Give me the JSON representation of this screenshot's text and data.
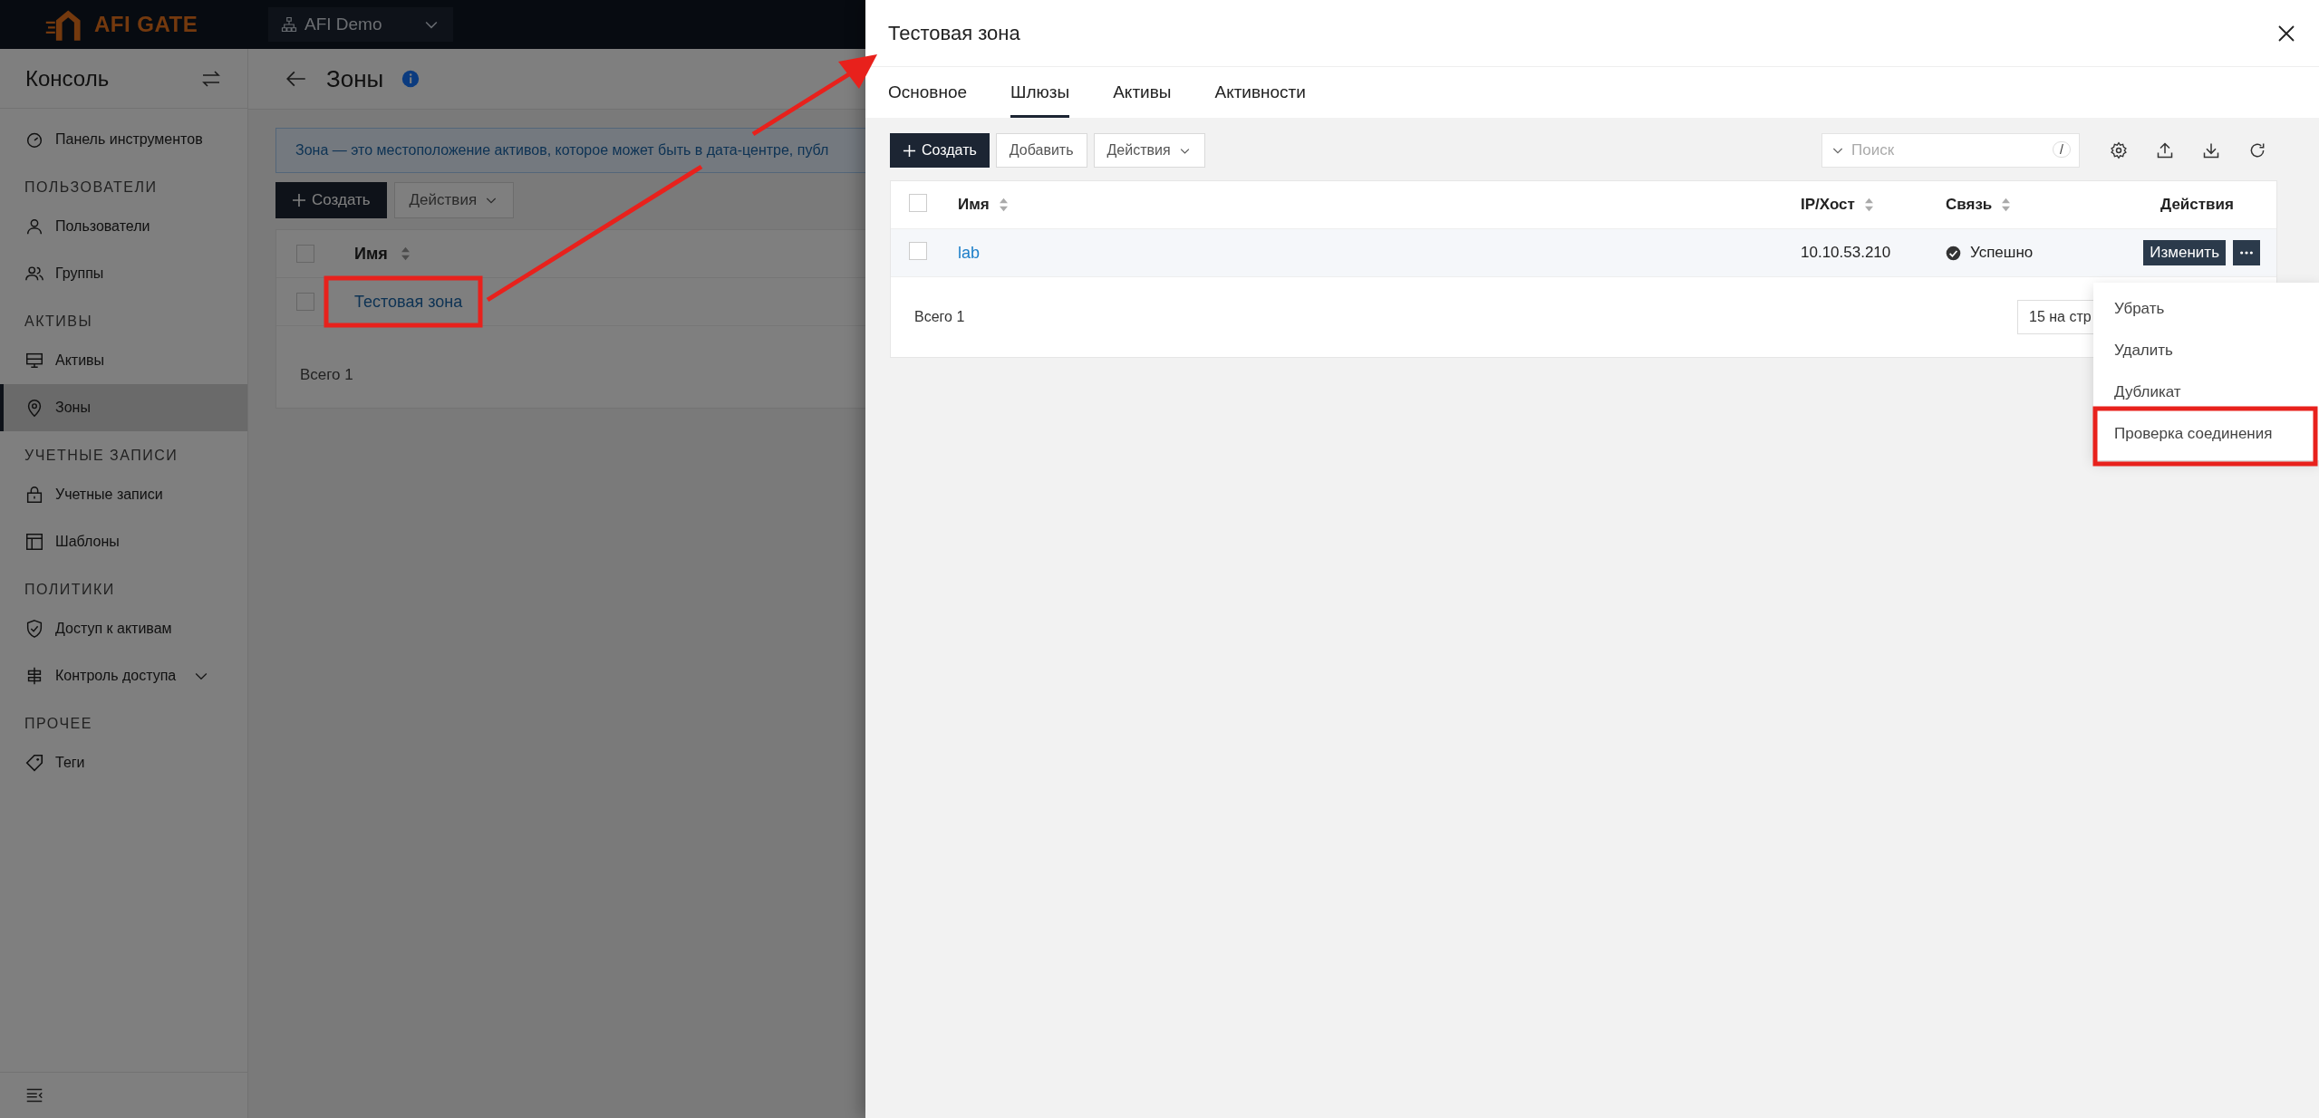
{
  "header": {
    "logo": "AFI GATE",
    "org_selector": "AFI Demo"
  },
  "sidebar": {
    "title": "Консоль",
    "items": [
      {
        "kind": "link",
        "label": "Панель инструментов",
        "selected": false
      },
      {
        "kind": "heading",
        "label": "ПОЛЬЗОВАТЕЛИ"
      },
      {
        "kind": "link",
        "label": "Пользователи",
        "selected": false
      },
      {
        "kind": "link",
        "label": "Группы",
        "selected": false
      },
      {
        "kind": "heading",
        "label": "АКТИВЫ"
      },
      {
        "kind": "link",
        "label": "Активы",
        "selected": false
      },
      {
        "kind": "link",
        "label": "Зоны",
        "selected": true
      },
      {
        "kind": "heading",
        "label": "УЧЕТНЫЕ ЗАПИСИ"
      },
      {
        "kind": "link",
        "label": "Учетные записи",
        "selected": false
      },
      {
        "kind": "link",
        "label": "Шаблоны",
        "selected": false
      },
      {
        "kind": "heading",
        "label": "ПОЛИТИКИ"
      },
      {
        "kind": "link",
        "label": "Доступ к активам",
        "selected": false
      },
      {
        "kind": "link",
        "label": "Контроль доступа",
        "selected": false,
        "expanded": false
      },
      {
        "kind": "heading",
        "label": "ПРОЧЕЕ"
      },
      {
        "kind": "link",
        "label": "Теги",
        "selected": false
      }
    ]
  },
  "page": {
    "title": "Зоны",
    "info": "Зона — это местоположение активов, которое может быть в дата-центре, публ",
    "create_button": "Создать",
    "actions_button": "Действия",
    "table": {
      "select_all_checked": false,
      "columns": [
        "Имя"
      ],
      "rows": [
        {
          "name": "Тестовая зона",
          "checked": false
        }
      ],
      "total": "Всего 1"
    }
  },
  "drawer": {
    "title": "Тестовая зона",
    "tabs": [
      {
        "label": "Основное",
        "selected": false
      },
      {
        "label": "Шлюзы",
        "selected": true
      },
      {
        "label": "Активы",
        "selected": false
      },
      {
        "label": "Активности",
        "selected": false
      }
    ],
    "toolbar": {
      "create_button": "Создать",
      "add_button": "Добавить",
      "actions_button": "Действия",
      "search": {
        "placeholder": "Поиск",
        "shortcut": "/"
      }
    },
    "table": {
      "select_all_checked": false,
      "columns": [
        "Имя",
        "IP/Хост",
        "Связь",
        "Действия"
      ],
      "rows": [
        {
          "name": "lab",
          "host": "10.10.53.210",
          "status": "Успешно",
          "edit_button": "Изменить",
          "checked": false
        }
      ],
      "total": "Всего 1",
      "page_size": "15 на стр"
    },
    "menu": [
      "Убрать",
      "Удалить",
      "Дубликат",
      "Проверка соединения"
    ]
  }
}
